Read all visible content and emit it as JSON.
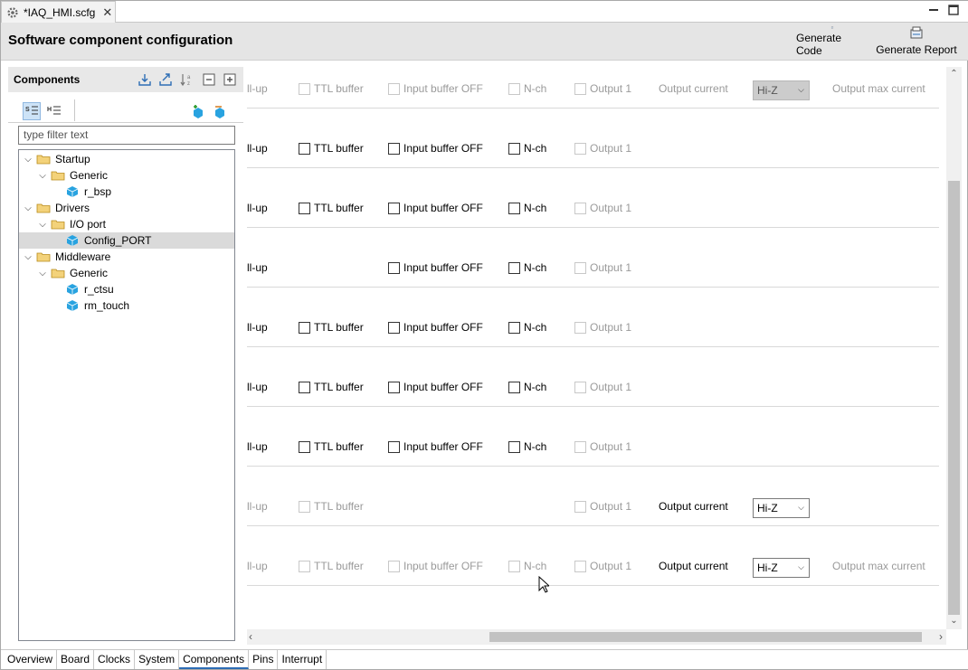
{
  "tab": {
    "title": "*IAQ_HMI.scfg",
    "icon": "gear-icon",
    "close_icon": "close-icon"
  },
  "header": {
    "title": "Software component configuration",
    "generate_code": "Generate Code",
    "generate_report": "Generate Report"
  },
  "components_panel": {
    "title": "Components",
    "filter_placeholder": "type filter text",
    "tree": [
      {
        "label": "Startup"
      },
      {
        "label": "Generic"
      },
      {
        "label": "r_bsp"
      },
      {
        "label": "Drivers"
      },
      {
        "label": "I/O port"
      },
      {
        "label": "Config_PORT",
        "selected": true
      },
      {
        "label": "Middleware"
      },
      {
        "label": "Generic"
      },
      {
        "label": "r_ctsu"
      },
      {
        "label": "rm_touch"
      }
    ]
  },
  "labels": {
    "pullup": "ll-up",
    "ttl": "TTL buffer",
    "ibo": "Input buffer OFF",
    "nch": "N-ch",
    "out1": "Output 1",
    "oc": "Output current",
    "omc": "Output max current",
    "hiz": "Hi-Z"
  },
  "bottom_tabs": [
    "Overview",
    "Board",
    "Clocks",
    "System",
    "Components",
    "Pins",
    "Interrupt"
  ],
  "active_bottom_tab": "Components",
  "colors": {
    "accent": "#2d6db5",
    "selection": "#dadada",
    "header_bg": "#e5e5e5"
  }
}
